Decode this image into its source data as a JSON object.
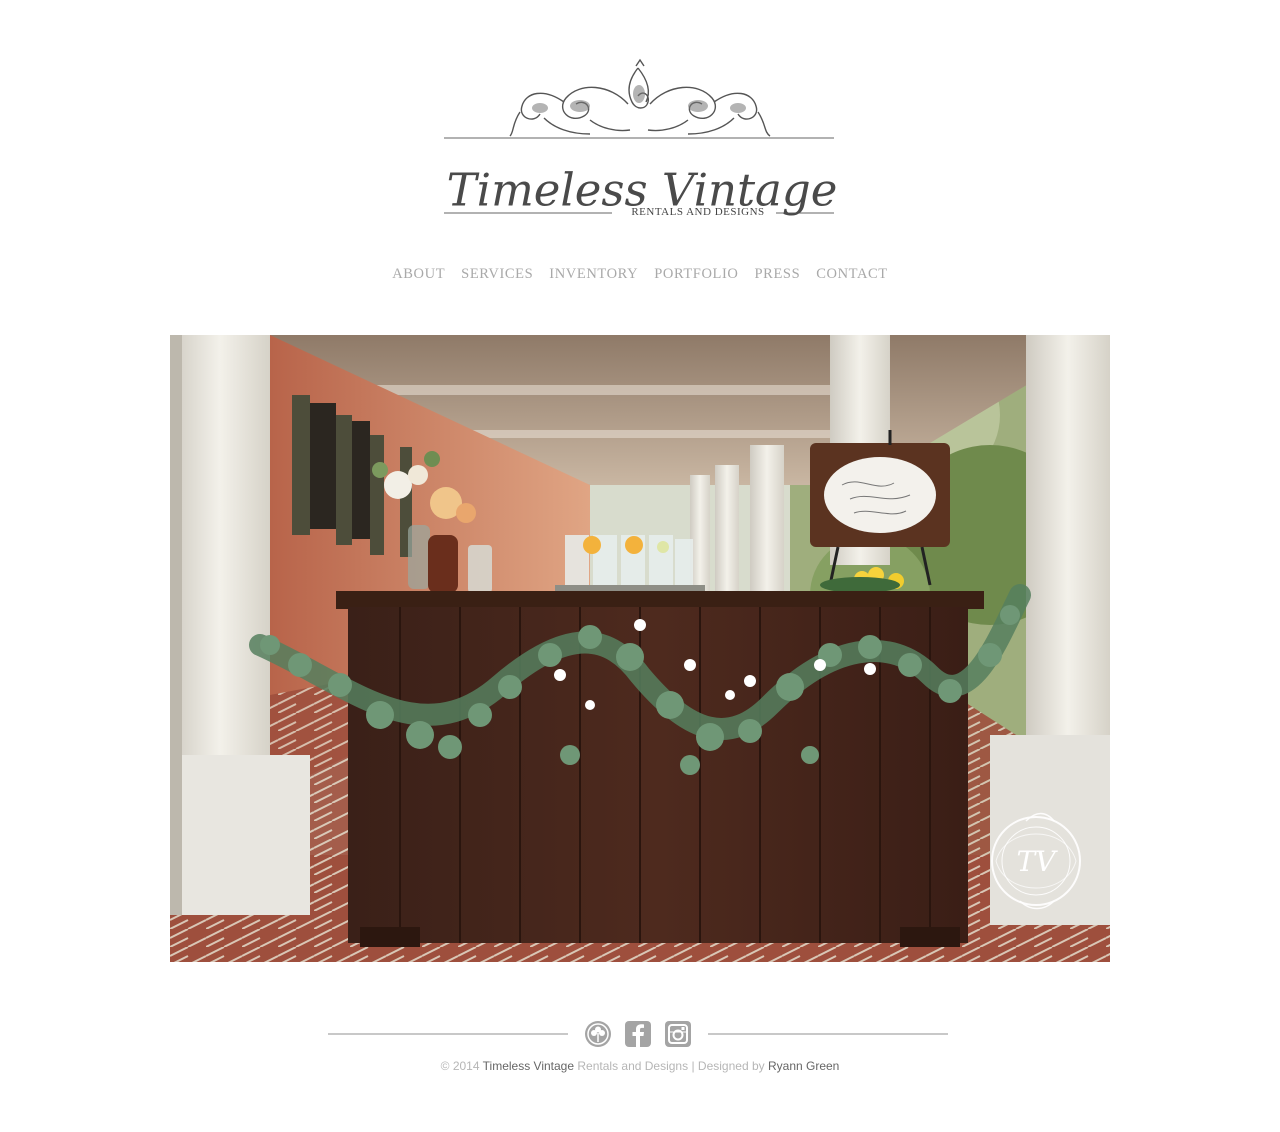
{
  "logo": {
    "wordmark": "Timeless Vintage",
    "tagline": "RENTALS AND DESIGNS"
  },
  "nav": {
    "items": [
      "ABOUT",
      "SERVICES",
      "INVENTORY",
      "PORTFOLIO",
      "PRESS",
      "CONTACT"
    ]
  },
  "hero": {
    "watermark_initials": "TV"
  },
  "social": {
    "icons": [
      "flower-icon",
      "facebook-icon",
      "instagram-icon"
    ]
  },
  "footer": {
    "copy_prefix": "© 2014",
    "brand": "Timeless Vintage",
    "brand_rest": "Rentals and Designs",
    "separator": "|",
    "designed_by": "Designed by",
    "designer": "Ryann Green"
  },
  "colors": {
    "nav_text": "#a9a9a9",
    "logo_text": "#4a4a4a",
    "social_icon_bg": "#a4a4a4",
    "footer_rule": "#c8c8c8"
  }
}
